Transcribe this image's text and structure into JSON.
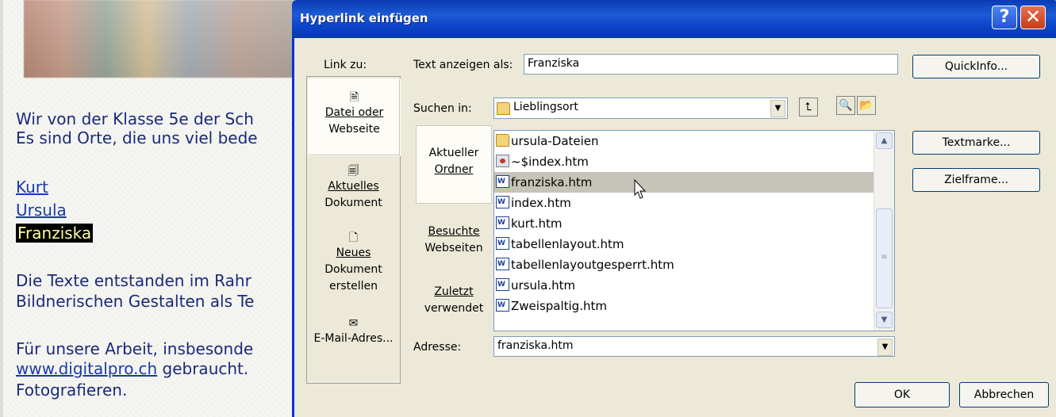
{
  "page": {
    "line1": "Wir von der Klasse 5e der Sch",
    "line2": "Es sind Orte, die uns viel bede",
    "links": [
      "Kurt",
      "Ursula",
      "Franziska"
    ],
    "line3": "Die Texte entstanden im Rahr",
    "line4": "Bildnerischen Gestalten als Te",
    "line5": "Für unsere Arbeit, insbesonde",
    "link_url": "www.digitalpro.ch",
    "line6_rest": " gebraucht.",
    "line7": "Fotografieren."
  },
  "dialog": {
    "title": "Hyperlink einfügen",
    "help_glyph": "?",
    "close_glyph": "✕",
    "link_to_label": "Link zu:",
    "link_to_items": [
      {
        "label1": "Datei oder",
        "label2": "Webseite",
        "icon": "web-file-icon"
      },
      {
        "label1": "Aktuelles",
        "label2": "Dokument",
        "icon": "current-document-icon"
      },
      {
        "label1": "Neues",
        "label2": "Dokument",
        "label3": "erstellen",
        "icon": "new-document-icon"
      },
      {
        "label1": "E-Mail-Adres...",
        "icon": "email-icon"
      }
    ],
    "text_label": "Text anzeigen als:",
    "text_value": "Franziska",
    "quickinfo_button": "QuickInfo...",
    "lookin_label": "Suchen in:",
    "lookin_value": "Lieblingsort",
    "look_tabs": [
      {
        "label1": "Aktueller",
        "label2": "Ordner"
      },
      {
        "label1": "Besuchte",
        "label2": "Webseiten"
      },
      {
        "label1": "Zuletzt",
        "label2": "verwendet"
      }
    ],
    "files": [
      {
        "name": "ursula-Dateien",
        "type": "folder"
      },
      {
        "name": "~$index.htm",
        "type": "ie"
      },
      {
        "name": "franziska.htm",
        "type": "word"
      },
      {
        "name": "index.htm",
        "type": "word"
      },
      {
        "name": "kurt.htm",
        "type": "word"
      },
      {
        "name": "tabellenlayout.htm",
        "type": "word"
      },
      {
        "name": "tabellenlayoutgesperrt.htm",
        "type": "word"
      },
      {
        "name": "ursula.htm",
        "type": "word"
      },
      {
        "name": "Zweispaltig.htm",
        "type": "word"
      }
    ],
    "textmarke_button": "Textmarke...",
    "zielframe_button": "Zielframe...",
    "address_label": "Adresse:",
    "address_value": "franziska.htm",
    "ok_button": "OK",
    "cancel_button": "Abbrechen"
  }
}
